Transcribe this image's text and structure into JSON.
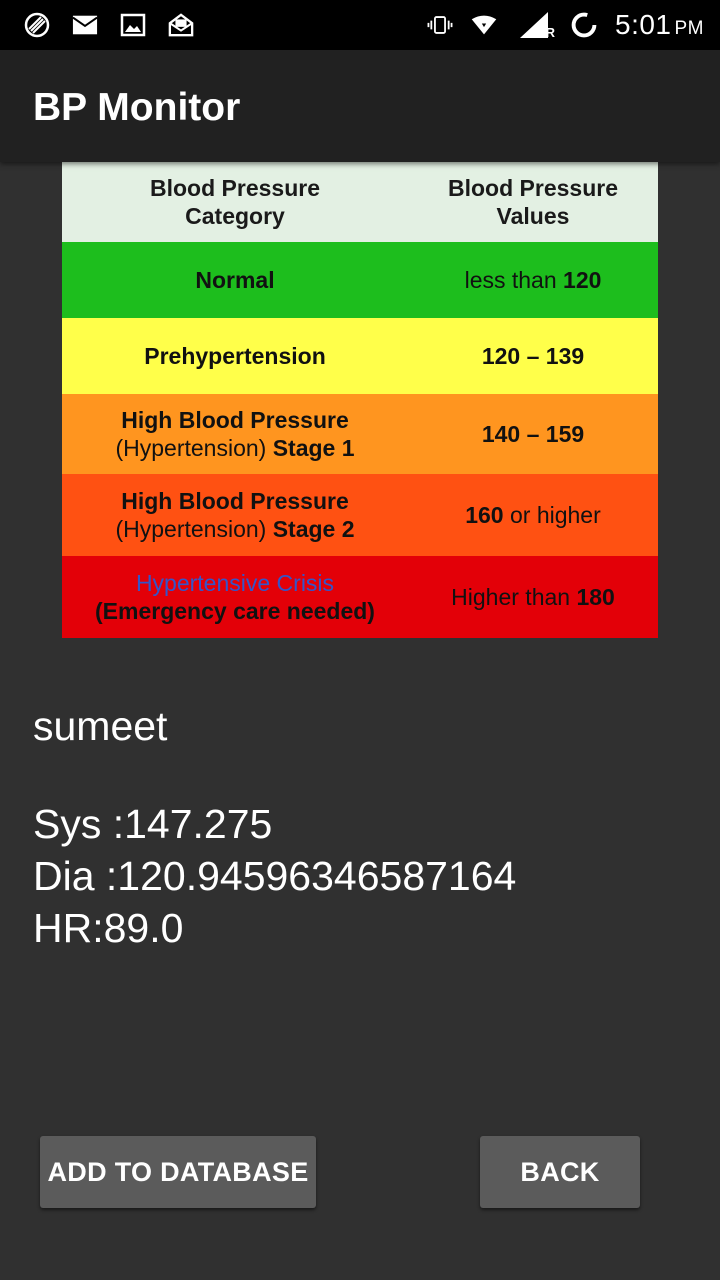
{
  "status_bar": {
    "icons_left": [
      "camera-aperture-icon",
      "mail-icon",
      "image-icon",
      "mail-open-icon"
    ],
    "icons_right": [
      "vibrate-icon",
      "wifi-icon",
      "signal-icon",
      "sync-icon"
    ],
    "signal_label": "R",
    "time": "5:01",
    "ampm": "PM"
  },
  "app_bar": {
    "title": "BP Monitor"
  },
  "bp_chart": {
    "header": {
      "category_line1": "Blood Pressure",
      "category_line2": "Category",
      "values_line1": "Blood Pressure",
      "values_line2": "Values"
    },
    "rows": [
      {
        "category": "Normal",
        "value_prefix": "less than ",
        "value_bold": "120",
        "color": "#1dbe1d"
      },
      {
        "category": "Prehypertension",
        "value_bold": "120 – 139",
        "color": "#ffff4a"
      },
      {
        "category_line1": "High Blood Pressure",
        "category_paren": "(Hypertension) ",
        "category_stage": "Stage 1",
        "value_bold": "140 – 159",
        "color": "#ff951f"
      },
      {
        "category_line1": "High Blood Pressure",
        "category_paren": "(Hypertension) ",
        "category_stage": "Stage 2",
        "value_bold": "160",
        "value_suffix": " or higher",
        "color": "#ff5112"
      },
      {
        "category_line1": "Hypertensive Crisis",
        "category_line2": "(Emergency care needed)",
        "value_prefix": "Higher than ",
        "value_bold": "180",
        "color": "#e30008"
      }
    ]
  },
  "result": {
    "name": "sumeet",
    "sys": "Sys :147.275",
    "dia": "Dia :120.94596346587164",
    "hr": "HR:89.0"
  },
  "buttons": {
    "add_label": "ADD TO DATABASE",
    "back_label": "BACK"
  }
}
